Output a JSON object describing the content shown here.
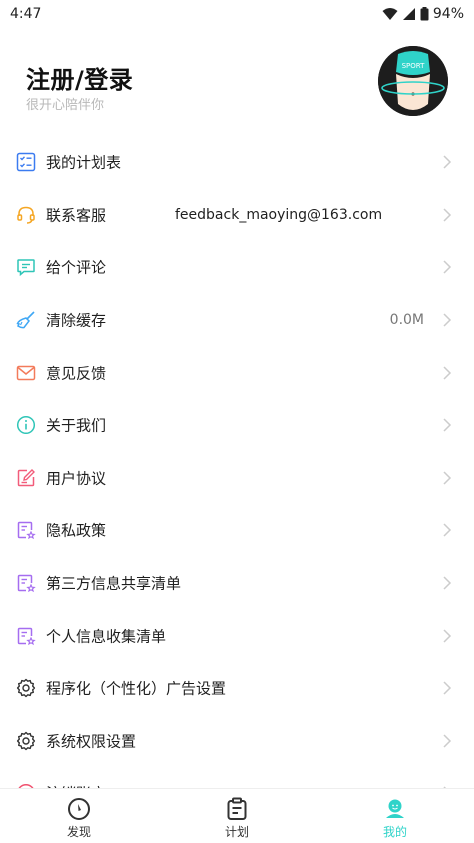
{
  "status_bar": {
    "time": "4:47",
    "battery": "94%",
    "icons": [
      "wifi-icon",
      "cellular-signal-icon",
      "battery-icon"
    ]
  },
  "header": {
    "title": "注册/登录",
    "subtitle": "很开心陪伴你",
    "avatar_text": "SPORT"
  },
  "menu": {
    "items": [
      {
        "label": "我的计划表",
        "icon": "checklist-icon",
        "value": ""
      },
      {
        "label": "联系客服",
        "icon": "headset-icon",
        "value": "feedback_maoying@163.com"
      },
      {
        "label": "给个评论",
        "icon": "comment-icon",
        "value": ""
      },
      {
        "label": "清除缓存",
        "icon": "broom-icon",
        "value": "0.0M"
      },
      {
        "label": "意见反馈",
        "icon": "mail-icon",
        "value": ""
      },
      {
        "label": "关于我们",
        "icon": "info-icon",
        "value": ""
      },
      {
        "label": "用户协议",
        "icon": "edit-document-icon",
        "value": ""
      },
      {
        "label": "隐私政策",
        "icon": "privacy-document-icon",
        "value": ""
      },
      {
        "label": "第三方信息共享清单",
        "icon": "shared-list-icon",
        "value": ""
      },
      {
        "label": "个人信息收集清单",
        "icon": "personal-list-icon",
        "value": ""
      },
      {
        "label": "程序化（个性化）广告设置",
        "icon": "gear-icon",
        "value": ""
      },
      {
        "label": "系统权限设置",
        "icon": "gear-icon",
        "value": ""
      },
      {
        "label": "注销账户",
        "icon": "power-icon",
        "value": ""
      }
    ]
  },
  "bottom_nav": {
    "items": [
      {
        "label": "发现",
        "icon": "compass-icon",
        "active": false
      },
      {
        "label": "计划",
        "icon": "clipboard-icon",
        "active": false
      },
      {
        "label": "我的",
        "icon": "user-icon",
        "active": true
      }
    ]
  },
  "colors": {
    "accent": "#2fd3c9",
    "checklist": "#3b7bf0",
    "headset": "#f5a623",
    "comment": "#2fc5b7",
    "broom": "#3fa7f5",
    "mail": "#f37b5b",
    "info": "#2fc5b7",
    "edit": "#f25c7a",
    "document": "#a56df0",
    "gear": "#333333",
    "power": "#f0506e"
  }
}
